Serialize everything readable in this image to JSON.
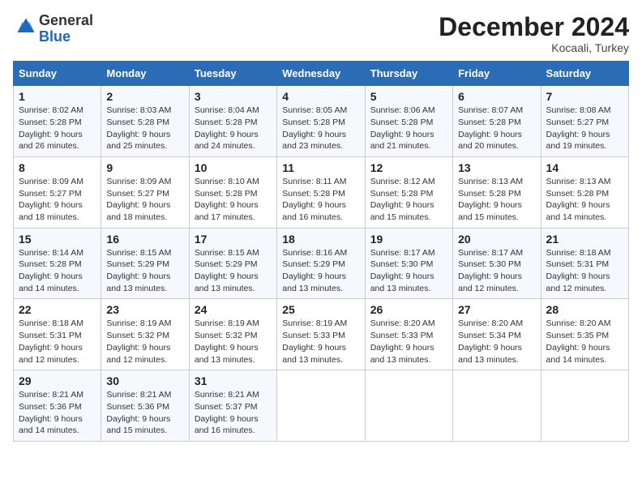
{
  "header": {
    "logo_line1": "General",
    "logo_line2": "Blue",
    "month": "December 2024",
    "location": "Kocaali, Turkey"
  },
  "weekdays": [
    "Sunday",
    "Monday",
    "Tuesday",
    "Wednesday",
    "Thursday",
    "Friday",
    "Saturday"
  ],
  "weeks": [
    [
      {
        "day": "1",
        "sunrise": "8:02 AM",
        "sunset": "5:28 PM",
        "daylight_hours": "9",
        "daylight_minutes": "26"
      },
      {
        "day": "2",
        "sunrise": "8:03 AM",
        "sunset": "5:28 PM",
        "daylight_hours": "9",
        "daylight_minutes": "25"
      },
      {
        "day": "3",
        "sunrise": "8:04 AM",
        "sunset": "5:28 PM",
        "daylight_hours": "9",
        "daylight_minutes": "24"
      },
      {
        "day": "4",
        "sunrise": "8:05 AM",
        "sunset": "5:28 PM",
        "daylight_hours": "9",
        "daylight_minutes": "23"
      },
      {
        "day": "5",
        "sunrise": "8:06 AM",
        "sunset": "5:28 PM",
        "daylight_hours": "9",
        "daylight_minutes": "21"
      },
      {
        "day": "6",
        "sunrise": "8:07 AM",
        "sunset": "5:28 PM",
        "daylight_hours": "9",
        "daylight_minutes": "20"
      },
      {
        "day": "7",
        "sunrise": "8:08 AM",
        "sunset": "5:27 PM",
        "daylight_hours": "9",
        "daylight_minutes": "19"
      }
    ],
    [
      {
        "day": "8",
        "sunrise": "8:09 AM",
        "sunset": "5:27 PM",
        "daylight_hours": "9",
        "daylight_minutes": "18"
      },
      {
        "day": "9",
        "sunrise": "8:09 AM",
        "sunset": "5:27 PM",
        "daylight_hours": "9",
        "daylight_minutes": "18"
      },
      {
        "day": "10",
        "sunrise": "8:10 AM",
        "sunset": "5:28 PM",
        "daylight_hours": "9",
        "daylight_minutes": "17"
      },
      {
        "day": "11",
        "sunrise": "8:11 AM",
        "sunset": "5:28 PM",
        "daylight_hours": "9",
        "daylight_minutes": "16"
      },
      {
        "day": "12",
        "sunrise": "8:12 AM",
        "sunset": "5:28 PM",
        "daylight_hours": "9",
        "daylight_minutes": "15"
      },
      {
        "day": "13",
        "sunrise": "8:13 AM",
        "sunset": "5:28 PM",
        "daylight_hours": "9",
        "daylight_minutes": "15"
      },
      {
        "day": "14",
        "sunrise": "8:13 AM",
        "sunset": "5:28 PM",
        "daylight_hours": "9",
        "daylight_minutes": "14"
      }
    ],
    [
      {
        "day": "15",
        "sunrise": "8:14 AM",
        "sunset": "5:28 PM",
        "daylight_hours": "9",
        "daylight_minutes": "14"
      },
      {
        "day": "16",
        "sunrise": "8:15 AM",
        "sunset": "5:29 PM",
        "daylight_hours": "9",
        "daylight_minutes": "13"
      },
      {
        "day": "17",
        "sunrise": "8:15 AM",
        "sunset": "5:29 PM",
        "daylight_hours": "9",
        "daylight_minutes": "13"
      },
      {
        "day": "18",
        "sunrise": "8:16 AM",
        "sunset": "5:29 PM",
        "daylight_hours": "9",
        "daylight_minutes": "13"
      },
      {
        "day": "19",
        "sunrise": "8:17 AM",
        "sunset": "5:30 PM",
        "daylight_hours": "9",
        "daylight_minutes": "13"
      },
      {
        "day": "20",
        "sunrise": "8:17 AM",
        "sunset": "5:30 PM",
        "daylight_hours": "9",
        "daylight_minutes": "12"
      },
      {
        "day": "21",
        "sunrise": "8:18 AM",
        "sunset": "5:31 PM",
        "daylight_hours": "9",
        "daylight_minutes": "12"
      }
    ],
    [
      {
        "day": "22",
        "sunrise": "8:18 AM",
        "sunset": "5:31 PM",
        "daylight_hours": "9",
        "daylight_minutes": "12"
      },
      {
        "day": "23",
        "sunrise": "8:19 AM",
        "sunset": "5:32 PM",
        "daylight_hours": "9",
        "daylight_minutes": "12"
      },
      {
        "day": "24",
        "sunrise": "8:19 AM",
        "sunset": "5:32 PM",
        "daylight_hours": "9",
        "daylight_minutes": "13"
      },
      {
        "day": "25",
        "sunrise": "8:19 AM",
        "sunset": "5:33 PM",
        "daylight_hours": "9",
        "daylight_minutes": "13"
      },
      {
        "day": "26",
        "sunrise": "8:20 AM",
        "sunset": "5:33 PM",
        "daylight_hours": "9",
        "daylight_minutes": "13"
      },
      {
        "day": "27",
        "sunrise": "8:20 AM",
        "sunset": "5:34 PM",
        "daylight_hours": "9",
        "daylight_minutes": "13"
      },
      {
        "day": "28",
        "sunrise": "8:20 AM",
        "sunset": "5:35 PM",
        "daylight_hours": "9",
        "daylight_minutes": "14"
      }
    ],
    [
      {
        "day": "29",
        "sunrise": "8:21 AM",
        "sunset": "5:36 PM",
        "daylight_hours": "9",
        "daylight_minutes": "14"
      },
      {
        "day": "30",
        "sunrise": "8:21 AM",
        "sunset": "5:36 PM",
        "daylight_hours": "9",
        "daylight_minutes": "15"
      },
      {
        "day": "31",
        "sunrise": "8:21 AM",
        "sunset": "5:37 PM",
        "daylight_hours": "9",
        "daylight_minutes": "16"
      },
      null,
      null,
      null,
      null
    ]
  ]
}
